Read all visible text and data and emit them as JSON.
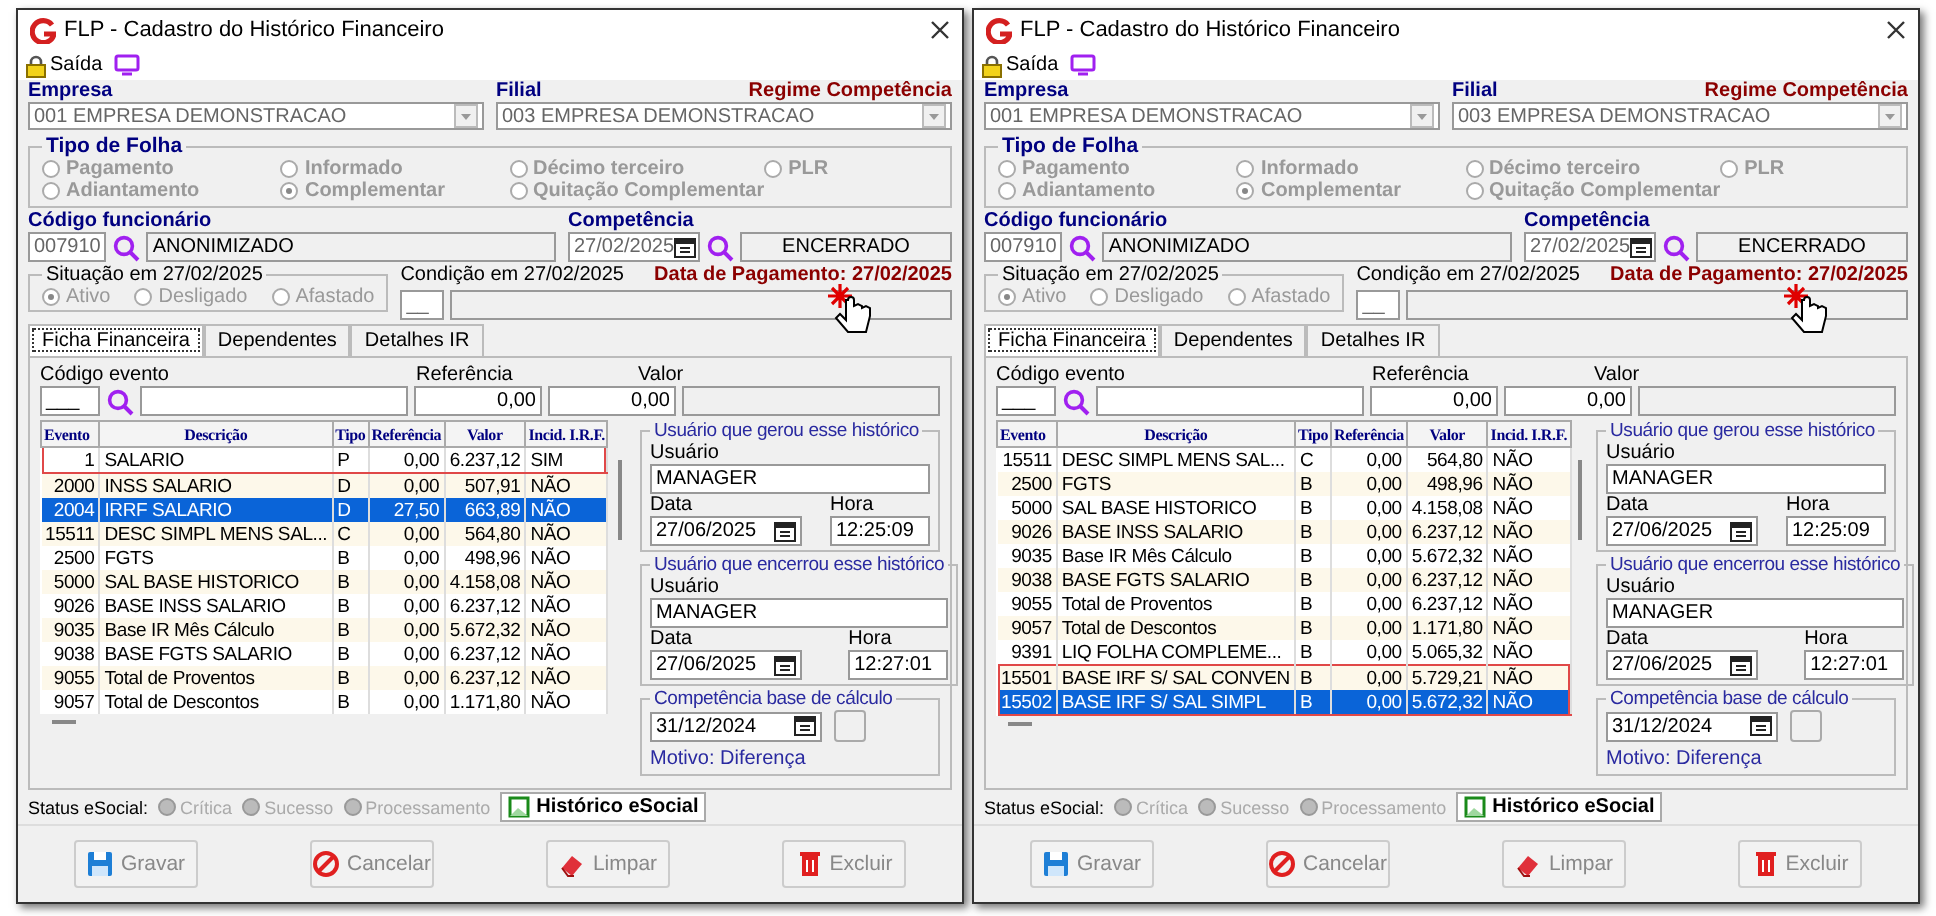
{
  "windows": [
    {
      "title": "FLP - Cadastro do Histórico Financeiro",
      "exit_label": "Saída",
      "empresa": {
        "label": "Empresa",
        "value": "001 EMPRESA DEMONSTRACAO"
      },
      "filial": {
        "label": "Filial",
        "value": "003 EMPRESA DEMONSTRACAO"
      },
      "regime": "Regime Competência",
      "tipo_folha": {
        "title": "Tipo de Folha",
        "options": [
          {
            "label": "Pagamento",
            "selected": false
          },
          {
            "label": "Informado",
            "selected": false
          },
          {
            "label": "Décimo terceiro",
            "selected": false
          },
          {
            "label": "PLR",
            "selected": false
          },
          {
            "label": "Adiantamento",
            "selected": false
          },
          {
            "label": "Complementar",
            "selected": true
          },
          {
            "label": "Quitação Complementar",
            "selected": false
          }
        ]
      },
      "funcionario": {
        "label": "Código funcionário",
        "code": "007910",
        "name": "ANONIMIZADO"
      },
      "competencia": {
        "label": "Competência",
        "date": "27/02/2025",
        "status": "ENCERRADO"
      },
      "situacao": {
        "title": "Situação em  27/02/2025",
        "options": [
          {
            "label": "Ativo",
            "selected": true
          },
          {
            "label": "Desligado",
            "selected": false
          },
          {
            "label": "Afastado",
            "selected": false
          }
        ]
      },
      "condicao": {
        "title": "Condição em 27/02/2025",
        "code": "__"
      },
      "data_pagamento": "Data de Pagamento: 27/02/2025",
      "tabs": [
        {
          "label": "Ficha Financeira",
          "selected": true
        },
        {
          "label": "Dependentes",
          "selected": false
        },
        {
          "label": "Detalhes IR",
          "selected": false
        }
      ],
      "evento_form": {
        "codigo_label": "Código evento",
        "codigo": "___",
        "referencia_label": "Referência",
        "referencia": "0,00",
        "valor_label": "Valor",
        "valor": "0,00"
      },
      "table": {
        "columns": [
          "Evento",
          "Descrição",
          "Tipo",
          "Referência",
          "Valor",
          "Incid. I.R.F."
        ],
        "rows": [
          {
            "cells": [
              "1",
              "SALARIO",
              "P",
              "0,00",
              "6.237,12",
              "SIM"
            ],
            "selected": false,
            "marked": true
          },
          {
            "cells": [
              "2000",
              "INSS SALARIO",
              "D",
              "0,00",
              "507,91",
              "NÃO"
            ],
            "selected": false,
            "marked": false
          },
          {
            "cells": [
              "2004",
              "IRRF SALARIO",
              "D",
              "27,50",
              "663,89",
              "NÃO"
            ],
            "selected": true,
            "marked": false
          },
          {
            "cells": [
              "15511",
              "DESC SIMPL MENS SAL...",
              "C",
              "0,00",
              "564,80",
              "NÃO"
            ],
            "selected": false,
            "marked": false
          },
          {
            "cells": [
              "2500",
              "FGTS",
              "B",
              "0,00",
              "498,96",
              "NÃO"
            ],
            "selected": false,
            "marked": false
          },
          {
            "cells": [
              "5000",
              "SAL BASE HISTORICO",
              "B",
              "0,00",
              "4.158,08",
              "NÃO"
            ],
            "selected": false,
            "marked": false
          },
          {
            "cells": [
              "9026",
              "BASE INSS SALARIO",
              "B",
              "0,00",
              "6.237,12",
              "NÃO"
            ],
            "selected": false,
            "marked": false
          },
          {
            "cells": [
              "9035",
              "Base IR Mês Cálculo",
              "B",
              "0,00",
              "5.672,32",
              "NÃO"
            ],
            "selected": false,
            "marked": false
          },
          {
            "cells": [
              "9038",
              "BASE FGTS SALARIO",
              "B",
              "0,00",
              "6.237,12",
              "NÃO"
            ],
            "selected": false,
            "marked": false
          },
          {
            "cells": [
              "9055",
              "Total de Proventos",
              "B",
              "0,00",
              "6.237,12",
              "NÃO"
            ],
            "selected": false,
            "marked": false
          },
          {
            "cells": [
              "9057",
              "Total de Descontos",
              "B",
              "0,00",
              "1.171,80",
              "NÃO"
            ],
            "selected": false,
            "marked": false
          }
        ]
      },
      "usuario_gerou": {
        "title": "Usuário que gerou esse histórico",
        "usuario_label": "Usuário",
        "usuario": "MANAGER",
        "data_label": "Data",
        "data": "27/06/2025",
        "hora_label": "Hora",
        "hora": "12:25:09"
      },
      "usuario_encerrou": {
        "title": "Usuário que encerrou esse histórico",
        "usuario_label": "Usuário",
        "usuario": "MANAGER",
        "data_label": "Data",
        "data": "27/06/2025",
        "hora_label": "Hora",
        "hora": "12:27:01"
      },
      "competencia_base": {
        "title": "Competência base de cálculo",
        "date": "31/12/2024",
        "motivo": "Motivo: Diferença"
      },
      "status_esocial": {
        "label": "Status eSocial:",
        "items": [
          "Crítica",
          "Sucesso",
          "Processamento"
        ]
      },
      "historico_button": "Histórico eSocial",
      "buttons": [
        "Gravar",
        "Cancelar",
        "Limpar",
        "Excluir"
      ]
    },
    {
      "title": "FLP - Cadastro do Histórico Financeiro",
      "exit_label": "Saída",
      "empresa": {
        "label": "Empresa",
        "value": "001 EMPRESA DEMONSTRACAO"
      },
      "filial": {
        "label": "Filial",
        "value": "003 EMPRESA DEMONSTRACAO"
      },
      "regime": "Regime Competência",
      "tipo_folha": {
        "title": "Tipo de Folha",
        "options": [
          {
            "label": "Pagamento",
            "selected": false
          },
          {
            "label": "Informado",
            "selected": false
          },
          {
            "label": "Décimo terceiro",
            "selected": false
          },
          {
            "label": "PLR",
            "selected": false
          },
          {
            "label": "Adiantamento",
            "selected": false
          },
          {
            "label": "Complementar",
            "selected": true
          },
          {
            "label": "Quitação Complementar",
            "selected": false
          }
        ]
      },
      "funcionario": {
        "label": "Código funcionário",
        "code": "007910",
        "name": "ANONIMIZADO"
      },
      "competencia": {
        "label": "Competência",
        "date": "27/02/2025",
        "status": "ENCERRADO"
      },
      "situacao": {
        "title": "Situação em  27/02/2025",
        "options": [
          {
            "label": "Ativo",
            "selected": true
          },
          {
            "label": "Desligado",
            "selected": false
          },
          {
            "label": "Afastado",
            "selected": false
          }
        ]
      },
      "condicao": {
        "title": "Condição em 27/02/2025",
        "code": "__"
      },
      "data_pagamento": "Data de Pagamento: 27/02/2025",
      "tabs": [
        {
          "label": "Ficha Financeira",
          "selected": true
        },
        {
          "label": "Dependentes",
          "selected": false
        },
        {
          "label": "Detalhes IR",
          "selected": false
        }
      ],
      "evento_form": {
        "codigo_label": "Código evento",
        "codigo": "___",
        "referencia_label": "Referência",
        "referencia": "0,00",
        "valor_label": "Valor",
        "valor": "0,00"
      },
      "table": {
        "columns": [
          "Evento",
          "Descrição",
          "Tipo",
          "Referência",
          "Valor",
          "Incid. I.R.F."
        ],
        "rows": [
          {
            "cells": [
              "15511",
              "DESC SIMPL MENS SAL...",
              "C",
              "0,00",
              "564,80",
              "NÃO"
            ],
            "selected": false,
            "marked": false
          },
          {
            "cells": [
              "2500",
              "FGTS",
              "B",
              "0,00",
              "498,96",
              "NÃO"
            ],
            "selected": false,
            "marked": false
          },
          {
            "cells": [
              "5000",
              "SAL BASE HISTORICO",
              "B",
              "0,00",
              "4.158,08",
              "NÃO"
            ],
            "selected": false,
            "marked": false
          },
          {
            "cells": [
              "9026",
              "BASE INSS SALARIO",
              "B",
              "0,00",
              "6.237,12",
              "NÃO"
            ],
            "selected": false,
            "marked": false
          },
          {
            "cells": [
              "9035",
              "Base IR Mês Cálculo",
              "B",
              "0,00",
              "5.672,32",
              "NÃO"
            ],
            "selected": false,
            "marked": false
          },
          {
            "cells": [
              "9038",
              "BASE FGTS SALARIO",
              "B",
              "0,00",
              "6.237,12",
              "NÃO"
            ],
            "selected": false,
            "marked": false
          },
          {
            "cells": [
              "9055",
              "Total de Proventos",
              "B",
              "0,00",
              "6.237,12",
              "NÃO"
            ],
            "selected": false,
            "marked": false
          },
          {
            "cells": [
              "9057",
              "Total de Descontos",
              "B",
              "0,00",
              "1.171,80",
              "NÃO"
            ],
            "selected": false,
            "marked": false
          },
          {
            "cells": [
              "9391",
              "LIQ FOLHA COMPLEME...",
              "B",
              "0,00",
              "5.065,32",
              "NÃO"
            ],
            "selected": false,
            "marked": false
          },
          {
            "cells": [
              "15501",
              "BASE IRF S/ SAL CONVEN",
              "B",
              "0,00",
              "5.729,21",
              "NÃO"
            ],
            "selected": false,
            "marked": true
          },
          {
            "cells": [
              "15502",
              "BASE IRF S/ SAL SIMPL",
              "B",
              "0,00",
              "5.672,32",
              "NÃO"
            ],
            "selected": true,
            "marked": true
          }
        ]
      },
      "usuario_gerou": {
        "title": "Usuário que gerou esse histórico",
        "usuario_label": "Usuário",
        "usuario": "MANAGER",
        "data_label": "Data",
        "data": "27/06/2025",
        "hora_label": "Hora",
        "hora": "12:25:09"
      },
      "usuario_encerrou": {
        "title": "Usuário que encerrou esse histórico",
        "usuario_label": "Usuário",
        "usuario": "MANAGER",
        "data_label": "Data",
        "data": "27/06/2025",
        "hora_label": "Hora",
        "hora": "12:27:01"
      },
      "competencia_base": {
        "title": "Competência base de cálculo",
        "date": "31/12/2024",
        "motivo": "Motivo: Diferença"
      },
      "status_esocial": {
        "label": "Status eSocial:",
        "items": [
          "Crítica",
          "Sucesso",
          "Processamento"
        ]
      },
      "historico_button": "Histórico eSocial",
      "buttons": [
        "Gravar",
        "Cancelar",
        "Limpar",
        "Excluir"
      ]
    }
  ]
}
